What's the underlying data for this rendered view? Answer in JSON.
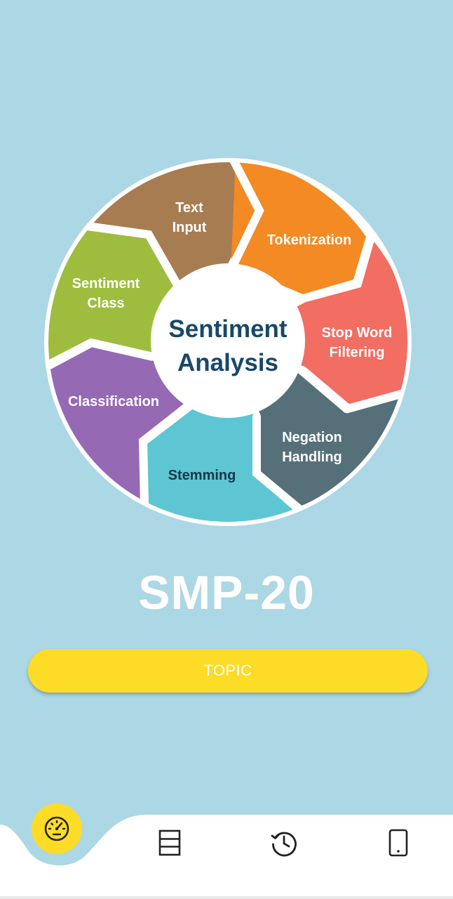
{
  "hero": {
    "center_line1": "Sentiment",
    "center_line2": "Analysis",
    "segments": [
      {
        "line1": "Text",
        "line2": "Input",
        "color": "#a87c51"
      },
      {
        "line1": "Tokenization",
        "line2": "",
        "color": "#f48a23"
      },
      {
        "line1": "Stop Word",
        "line2": "Filtering",
        "color": "#f26d62"
      },
      {
        "line1": "Negation",
        "line2": "Handling",
        "color": "#56707a"
      },
      {
        "line1": "Stemming",
        "line2": "",
        "color": "#5ec6d3"
      },
      {
        "line1": "Classification",
        "line2": "",
        "color": "#9569b3"
      },
      {
        "line1": "Sentiment",
        "line2": "Class",
        "color": "#9ebd3f"
      }
    ]
  },
  "app_title": "SMP-20",
  "topic_button": {
    "label": "TOPIC"
  },
  "colors": {
    "background": "#acd7e5",
    "accent": "#fcdc26",
    "nav_background": "#ffffff"
  },
  "bottom_nav": {
    "items": [
      {
        "icon": "speedometer-icon",
        "active": true
      },
      {
        "icon": "list-icon",
        "active": false
      },
      {
        "icon": "history-icon",
        "active": false
      },
      {
        "icon": "phone-icon",
        "active": false
      }
    ]
  }
}
